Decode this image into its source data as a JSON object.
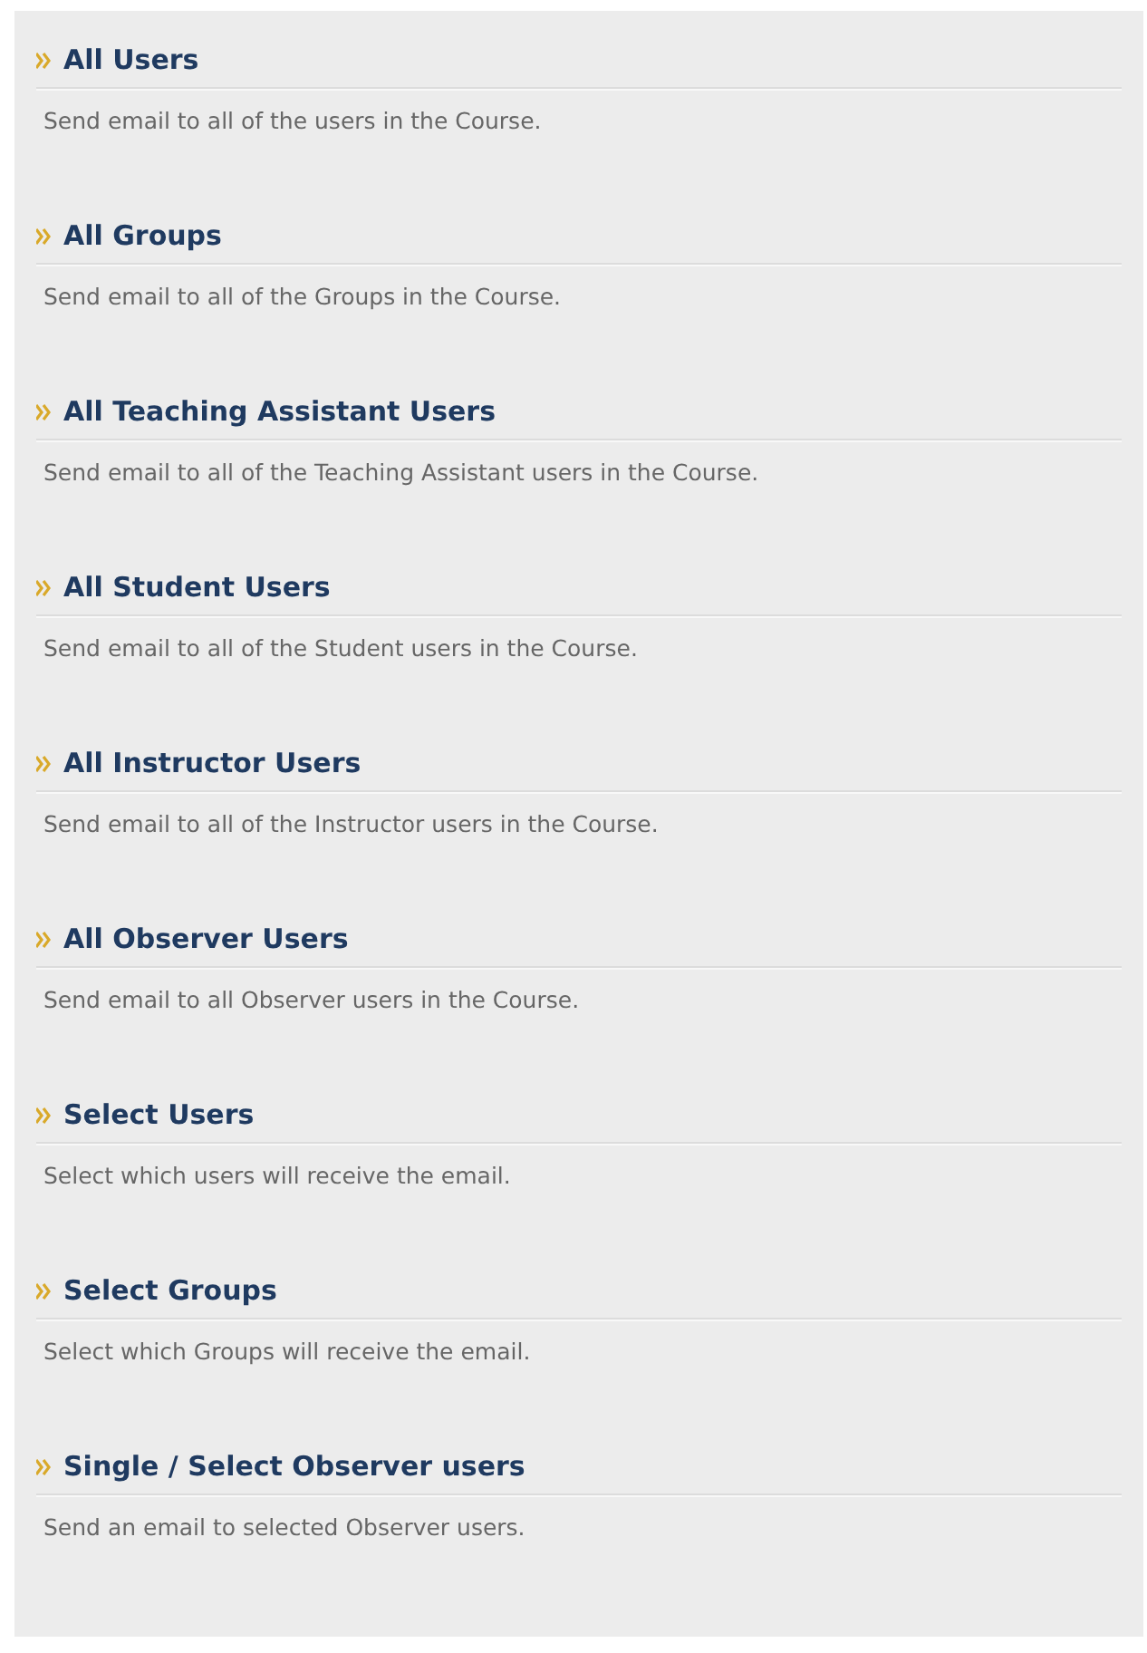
{
  "options": [
    {
      "title": "All Users",
      "description": "Send email to all of the users in the Course."
    },
    {
      "title": "All Groups",
      "description": "Send email to all of the Groups in the Course."
    },
    {
      "title": "All Teaching Assistant Users",
      "description": "Send email to all of the Teaching Assistant users in the Course."
    },
    {
      "title": "All Student Users",
      "description": "Send email to all of the Student users in the Course."
    },
    {
      "title": "All Instructor Users",
      "description": "Send email to all of the Instructor users in the Course."
    },
    {
      "title": "All Observer Users",
      "description": "Send email to all Observer users in the Course."
    },
    {
      "title": "Select Users",
      "description": "Select which users will receive the email."
    },
    {
      "title": "Select Groups",
      "description": "Select which Groups will receive the email."
    },
    {
      "title": "Single / Select Observer users",
      "description": "Send an email to selected Observer users."
    }
  ]
}
